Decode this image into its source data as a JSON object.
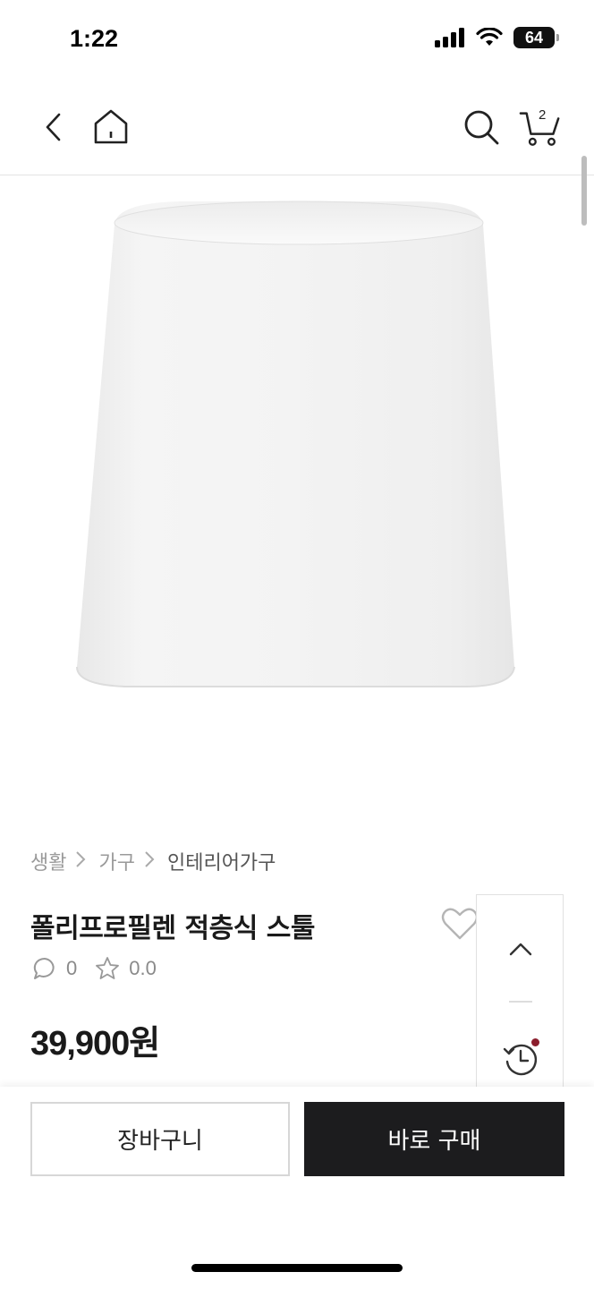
{
  "status_bar": {
    "time": "1:22",
    "battery": "64",
    "icons": [
      "signal-icon",
      "wifi-icon",
      "battery-icon"
    ]
  },
  "header": {
    "icons": [
      "back-icon",
      "home-icon",
      "search-icon",
      "cart-icon"
    ],
    "cart_count": "2"
  },
  "breadcrumb": {
    "items": [
      "생활",
      "가구",
      "인테리어가구"
    ]
  },
  "product": {
    "title": "폴리프로필렌 적층식 스툴",
    "comment_count": "0",
    "rating": "0.0",
    "price": "39,900원"
  },
  "side_panel": {
    "icons": [
      "chevron-up-icon",
      "history-icon"
    ],
    "notification_color": "#8b1e2d"
  },
  "actions": {
    "cart_label": "장바구니",
    "buy_label": "바로 구매"
  },
  "colors": {
    "buy_button": "#1c1c1e",
    "text": "#1a1a1a",
    "muted": "#999999"
  }
}
